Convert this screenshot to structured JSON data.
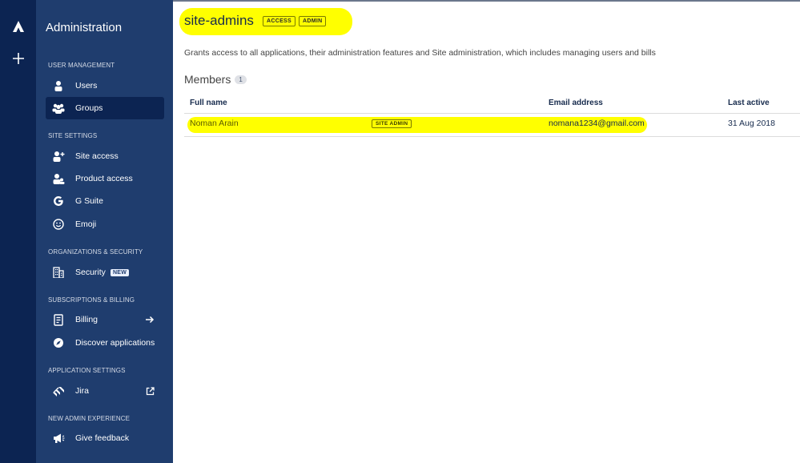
{
  "rail": {
    "logo_icon": "atlassian-logo-icon",
    "add_icon": "plus-icon"
  },
  "sidebar": {
    "title": "Administration",
    "sections": {
      "user_management": "USER MANAGEMENT",
      "site_settings": "SITE SETTINGS",
      "org_security": "ORGANIZATIONS & SECURITY",
      "billing": "SUBSCRIPTIONS & BILLING",
      "app_settings": "APPLICATION SETTINGS",
      "new_admin": "NEW ADMIN EXPERIENCE"
    },
    "items": {
      "users": "Users",
      "groups": "Groups",
      "site_access": "Site access",
      "product_access": "Product access",
      "g_suite": "G Suite",
      "emoji": "Emoji",
      "security": "Security",
      "security_badge": "NEW",
      "billing": "Billing",
      "discover": "Discover applications",
      "jira": "Jira",
      "feedback": "Give feedback"
    },
    "active_item": "Groups"
  },
  "main": {
    "group_name": "site-admins",
    "lozenges": [
      "ACCESS",
      "ADMIN"
    ],
    "description": "Grants access to all applications, their administration features and Site administration, which includes managing users and bills",
    "members_title": "Members",
    "members_count": "1",
    "columns": {
      "name": "Full name",
      "email": "Email address",
      "last_active": "Last active"
    },
    "rows": [
      {
        "name": "Noman Arain",
        "badge": "SITE ADMIN",
        "email": "nomana1234@gmail.com",
        "last_active": "31 Aug 2018"
      }
    ]
  },
  "colors": {
    "rail_bg": "#0c2452",
    "sidebar_bg": "#1f3d6e",
    "highlight": "#ffff00"
  }
}
